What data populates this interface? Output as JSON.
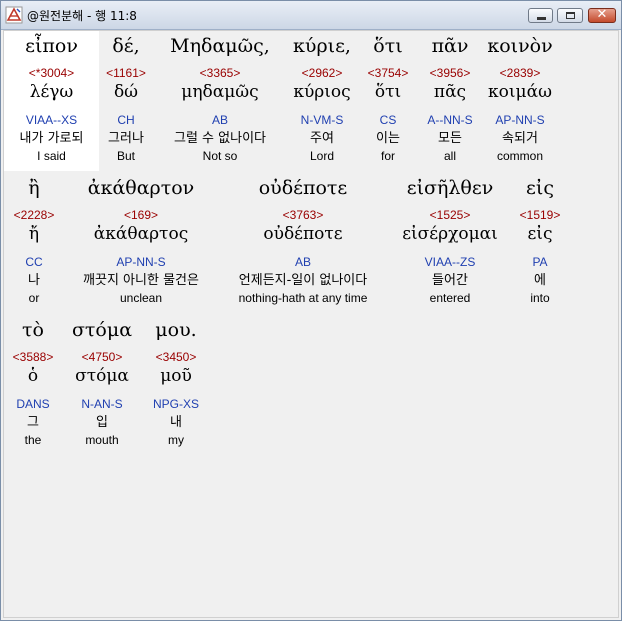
{
  "window": {
    "title": "@원전분해 - 행 11:8"
  },
  "controls": {
    "minimize": "minimize",
    "maximize": "maximize",
    "close": "✕"
  },
  "rows": [
    {
      "words": [
        {
          "greek": "εἶπον",
          "strong": "<*3004>",
          "lemma": "λέγω",
          "morph": "VIAA--XS",
          "korean": "내가 가로되",
          "english": "I said",
          "selected": true
        },
        {
          "greek": "δέ,",
          "strong": "<1161>",
          "lemma": "δώ",
          "morph": "CH",
          "korean": "그러나",
          "english": "But"
        },
        {
          "greek": "Μηδαμῶς,",
          "strong": "<3365>",
          "lemma": "μηδαμῶς",
          "morph": "AB",
          "korean": "그럴 수 없나이다",
          "english": "Not so"
        },
        {
          "greek": "κύριε,",
          "strong": "<2962>",
          "lemma": "κύριος",
          "morph": "N-VM-S",
          "korean": "주여",
          "english": "Lord"
        },
        {
          "greek": "ὅτι",
          "strong": "<3754>",
          "lemma": "ὅτι",
          "morph": "CS",
          "korean": "이는",
          "english": "for"
        },
        {
          "greek": "πᾶν",
          "strong": "<3956>",
          "lemma": "πᾶς",
          "morph": "A--NN-S",
          "korean": "모든",
          "english": "all"
        },
        {
          "greek": "κοινὸν",
          "strong": "<2839>",
          "lemma": "κοιμάω",
          "morph": "AP-NN-S",
          "korean": "속되거",
          "english": "common"
        }
      ]
    },
    {
      "words": [
        {
          "greek": "ἢ",
          "strong": "<2228>",
          "lemma": "ἤ",
          "morph": "CC",
          "korean": "나",
          "english": "or"
        },
        {
          "greek": "ἀκάθαρτον",
          "strong": "<169>",
          "lemma": "ἀκάθαρτος",
          "morph": "AP-NN-S",
          "korean": "깨끗지 아니한 물건은",
          "english": "unclean"
        },
        {
          "greek": "οὐδέποτε",
          "strong": "<3763>",
          "lemma": "οὐδέποτε",
          "morph": "AB",
          "korean": "언제든지-일이 없나이다",
          "english": "nothing-hath at any time"
        },
        {
          "greek": "εἰσῆλθεν",
          "strong": "<1525>",
          "lemma": "εἰσέρχομαι",
          "morph": "VIAA--ZS",
          "korean": "들어간",
          "english": "entered"
        },
        {
          "greek": "εἰς",
          "strong": "<1519>",
          "lemma": "εἰς",
          "morph": "PA",
          "korean": "에",
          "english": "into"
        }
      ]
    },
    {
      "words": [
        {
          "greek": "τὸ",
          "strong": "<3588>",
          "lemma": "ὁ",
          "morph": "DANS",
          "korean": "그",
          "english": "the"
        },
        {
          "greek": "στόμα",
          "strong": "<4750>",
          "lemma": "στόμα",
          "morph": "N-AN-S",
          "korean": "입",
          "english": "mouth"
        },
        {
          "greek": "μου.",
          "strong": "<3450>",
          "lemma": "μοῦ",
          "morph": "NPG-XS",
          "korean": "내",
          "english": "my"
        }
      ]
    }
  ]
}
